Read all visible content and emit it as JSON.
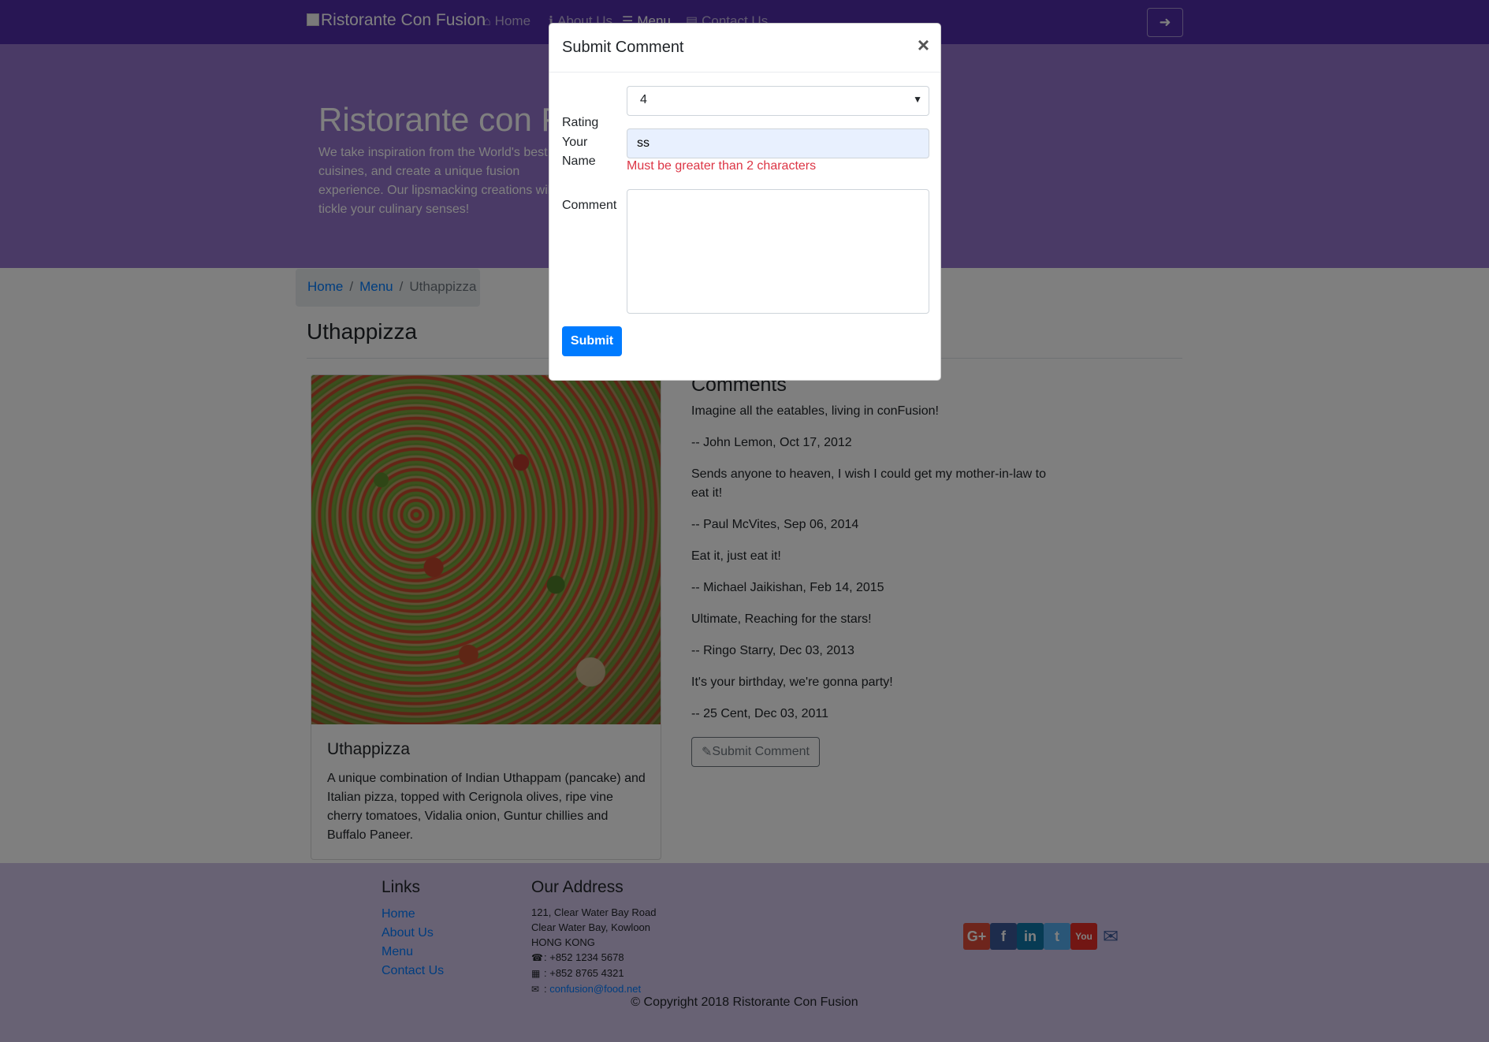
{
  "navbar": {
    "brand": "Ristorante Con Fusion",
    "items": [
      {
        "label": "Home",
        "icon": "home-icon"
      },
      {
        "label": "About Us",
        "icon": "info-icon"
      },
      {
        "label": "Menu",
        "icon": "list-icon"
      },
      {
        "label": "Contact Us",
        "icon": "address-card-icon"
      }
    ]
  },
  "jumbotron": {
    "title": "Ristorante con Fusion",
    "text": "We take inspiration from the World's best cuisines, and create a unique fusion experience. Our lipsmacking creations will tickle your culinary senses!"
  },
  "breadcrumb": {
    "home": "Home",
    "menu": "Menu",
    "current": "Uthappizza"
  },
  "dish": {
    "heading": "Uthappizza",
    "name": "Uthappizza",
    "description": "A unique combination of Indian Uthappam (pancake) and Italian pizza, topped with Cerignola olives, ripe vine cherry tomatoes, Vidalia onion, Guntur chillies and Buffalo Paneer."
  },
  "comments": {
    "heading": "Comments",
    "items": [
      {
        "text": "Imagine all the eatables, living in conFusion!",
        "author": "-- John Lemon, Oct 17, 2012"
      },
      {
        "text": "Sends anyone to heaven, I wish I could get my mother-in-law to eat it!",
        "author": "-- Paul McVites, Sep 06, 2014"
      },
      {
        "text": "Eat it, just eat it!",
        "author": "-- Michael Jaikishan, Feb 14, 2015"
      },
      {
        "text": "Ultimate, Reaching for the stars!",
        "author": "-- Ringo Starry, Dec 03, 2013"
      },
      {
        "text": "It's your birthday, we're gonna party!",
        "author": "-- 25 Cent, Dec 03, 2011"
      }
    ],
    "button": "Submit Comment"
  },
  "footer": {
    "links_heading": "Links",
    "links": [
      "Home",
      "About Us",
      "Menu",
      "Contact Us"
    ],
    "address_heading": "Our Address",
    "address": [
      "121, Clear Water Bay Road",
      "Clear Water Bay, Kowloon",
      "HONG KONG"
    ],
    "phone": ": +852 1234 5678",
    "fax": ": +852 8765 4321",
    "email_prefix": ": ",
    "email": "confusion@food.net",
    "social": [
      "google-plus-icon",
      "facebook-icon",
      "linkedin-icon",
      "twitter-icon",
      "youtube-icon",
      "envelope-icon"
    ],
    "copyright": "© Copyright 2018 Ristorante Con Fusion"
  },
  "modal": {
    "title": "Submit Comment",
    "close": "×",
    "rating_label": "Rating",
    "rating_value": "4",
    "name_label": "Your Name",
    "name_value": "ss",
    "name_error": "Must be greater than 2 characters",
    "comment_label": "Comment",
    "comment_value": "",
    "submit": "Submit"
  },
  "colors": {
    "primary": "#512DA8",
    "light": "#9575CD",
    "footer": "#D1C4E9",
    "link": "#007bff",
    "error": "#dc3545"
  }
}
